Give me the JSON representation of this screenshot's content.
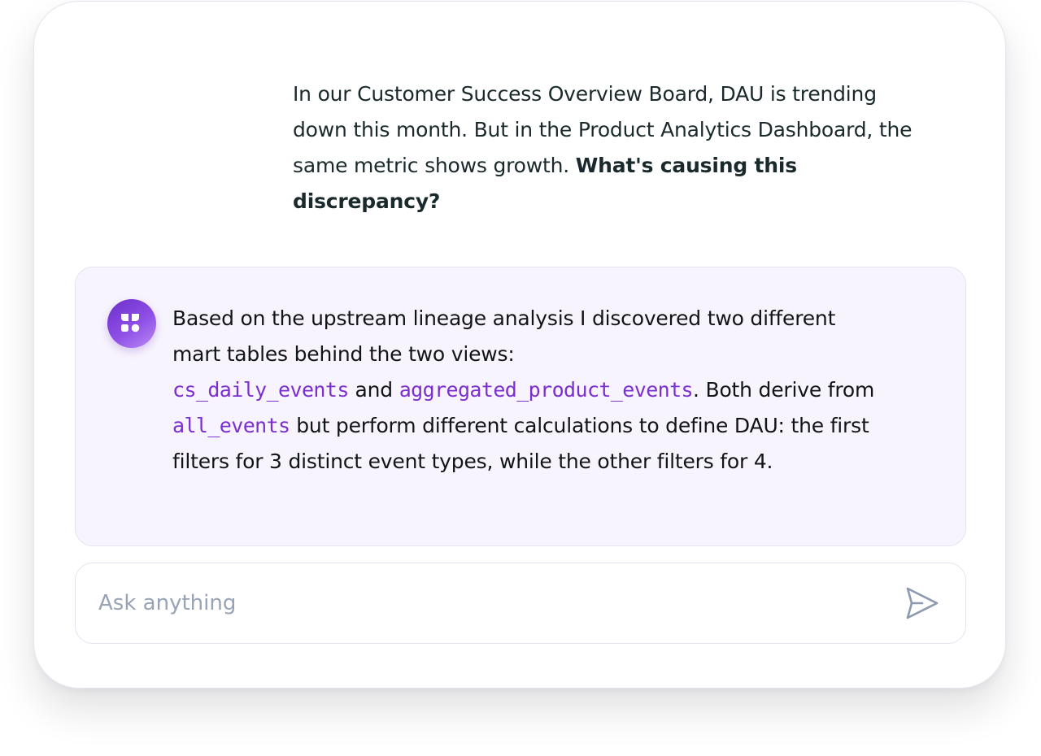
{
  "conversation": {
    "user_message": {
      "text": "In our Customer Success Overview Board, DAU is trending down this month. But in the Product Analytics Dashboard, the same metric shows growth.",
      "emphasis": "What's causing this discrepancy?"
    },
    "assistant_message": {
      "avatar_icon": "shapes-logo-icon",
      "part1": "Based on the upstream lineage analysis I discovered two different mart tables behind the two views:",
      "table1": "cs_daily_events",
      "and": "and",
      "table2": "aggregated_product_events",
      "part2": ". Both derive from",
      "table3": "all_events",
      "part3": "but perform different calculations to define DAU: the first filters for 3 distinct event types, while the other filters for 4."
    }
  },
  "composer": {
    "placeholder": "Ask anything",
    "value": "",
    "send_icon": "send-icon"
  },
  "colors": {
    "accent": "#7b2fd0",
    "assistant_bg": "#f8f4fd",
    "placeholder": "#98a3b6"
  }
}
